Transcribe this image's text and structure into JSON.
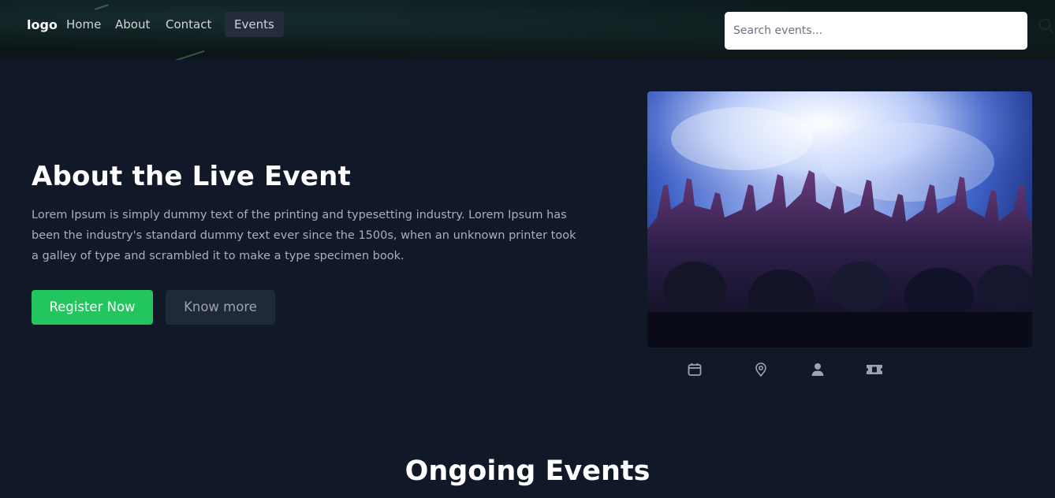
{
  "nav": {
    "logo": "logo",
    "links": [
      "Home",
      "About",
      "Contact",
      "Events"
    ],
    "active_link": "Events",
    "search_placeholder": "Search events..."
  },
  "hero": {
    "title": "About the Live Event",
    "description": "Lorem Ipsum is simply dummy text of the printing and typesetting industry. Lorem Ipsum has been the industry's standard dummy text ever since the 1500s, when an unknown printer took a galley of type and scrambled it to make a type specimen book.",
    "primary_button": "Register Now",
    "secondary_button": "Know more",
    "image_subject": "concert crowd with raised hands under blue stage lights",
    "info_icons": [
      "calendar-icon",
      "location-pin-icon",
      "user-icon",
      "ticket-icon"
    ]
  },
  "sections": {
    "ongoing_title": "Ongoing Events"
  },
  "colors": {
    "background": "#111827",
    "primary": "#22c55e",
    "secondary": "#1f2937",
    "muted_text": "#a8b0bd"
  }
}
